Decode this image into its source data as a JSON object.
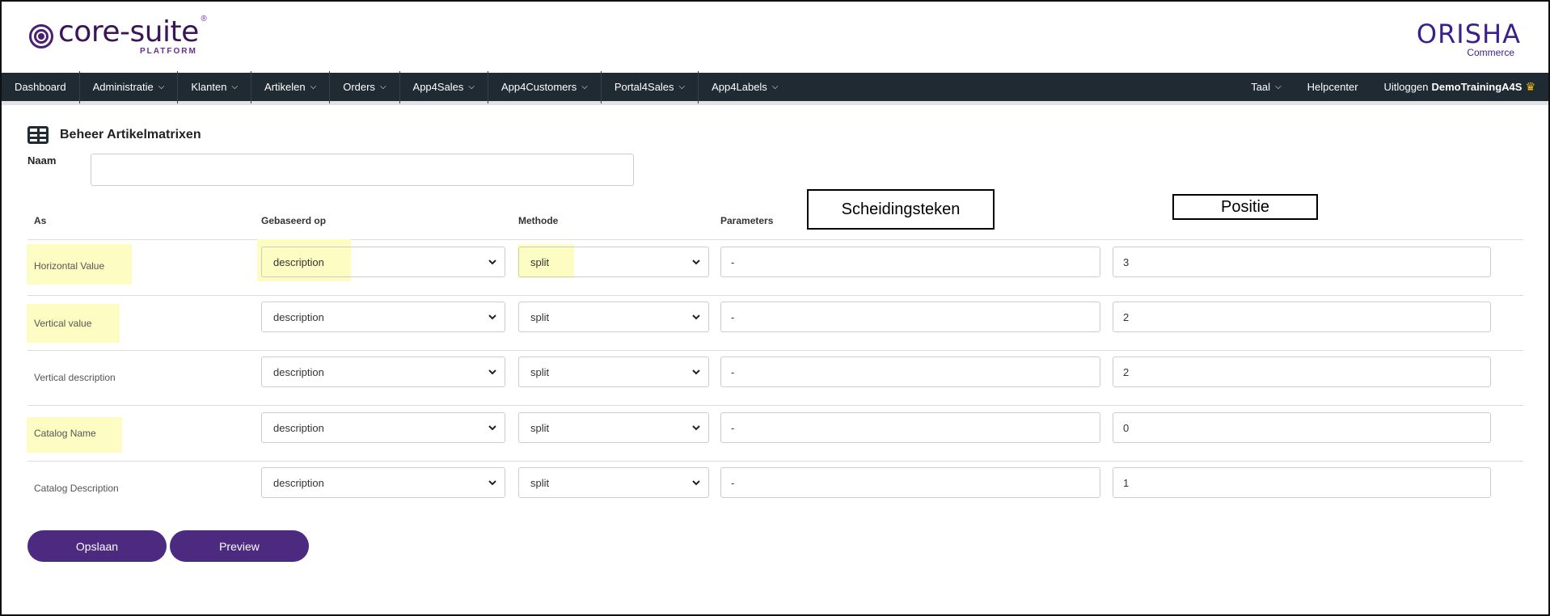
{
  "header": {
    "brand_name": "core-suite",
    "brand_sub": "PLATFORM",
    "brand_reg": "®",
    "partner_name": "ORISHA",
    "partner_sub": "Commerce"
  },
  "nav": {
    "items": [
      {
        "label": "Dashboard",
        "dropdown": false
      },
      {
        "label": "Administratie",
        "dropdown": true
      },
      {
        "label": "Klanten",
        "dropdown": true
      },
      {
        "label": "Artikelen",
        "dropdown": true
      },
      {
        "label": "Orders",
        "dropdown": true
      },
      {
        "label": "App4Sales",
        "dropdown": true
      },
      {
        "label": "App4Customers",
        "dropdown": true
      },
      {
        "label": "Portal4Sales",
        "dropdown": true
      },
      {
        "label": "App4Labels",
        "dropdown": true
      }
    ],
    "right": {
      "language": "Taal",
      "help": "Helpcenter",
      "logout": "Uitloggen",
      "user": "DemoTrainingA4S"
    }
  },
  "page": {
    "title": "Beheer Artikelmatrixen",
    "naam_label": "Naam",
    "naam_value": ""
  },
  "table": {
    "headers": {
      "as": "As",
      "gebaseerd_op": "Gebaseerd op",
      "methode": "Methode",
      "parameters": "Parameters"
    },
    "rows": [
      {
        "as": "Horizontal Value",
        "gebaseerd_op": "description",
        "methode": "split",
        "scheidingsteken": "-",
        "positie": "3"
      },
      {
        "as": "Vertical value",
        "gebaseerd_op": "description",
        "methode": "split",
        "scheidingsteken": "-",
        "positie": "2"
      },
      {
        "as": "Vertical description",
        "gebaseerd_op": "description",
        "methode": "split",
        "scheidingsteken": "-",
        "positie": "2"
      },
      {
        "as": "Catalog Name",
        "gebaseerd_op": "description",
        "methode": "split",
        "scheidingsteken": "-",
        "positie": "0"
      },
      {
        "as": "Catalog Description",
        "gebaseerd_op": "description",
        "methode": "split",
        "scheidingsteken": "-",
        "positie": "1"
      }
    ]
  },
  "callouts": {
    "scheidingsteken": "Scheidingsteken",
    "positie": "Positie"
  },
  "buttons": {
    "save": "Opslaan",
    "preview": "Preview"
  },
  "colors": {
    "nav_bg": "#1f2a33",
    "button_bg": "#4b2a7f",
    "highlight": "#fdfcc2",
    "brand": "#3b1556"
  }
}
